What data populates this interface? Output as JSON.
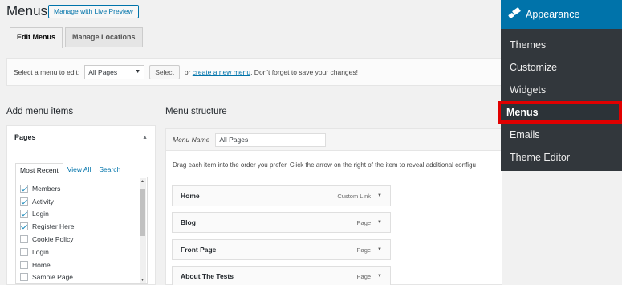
{
  "header": {
    "title": "Menus",
    "live_preview_label": "Manage with Live Preview"
  },
  "tabs": [
    {
      "label": "Edit Menus",
      "active": true
    },
    {
      "label": "Manage Locations",
      "active": false
    }
  ],
  "select_bar": {
    "label": "Select a menu to edit:",
    "selected": "All Pages",
    "select_button": "Select",
    "or_text": "or",
    "create_link": "create a new menu",
    "tail_text": ". Don't forget to save your changes!"
  },
  "add_items": {
    "heading": "Add menu items",
    "panel_title": "Pages",
    "subtabs": [
      "Most Recent",
      "View All",
      "Search"
    ],
    "pages": [
      {
        "label": "Members",
        "checked": true
      },
      {
        "label": "Activity",
        "checked": true
      },
      {
        "label": "Login",
        "checked": true
      },
      {
        "label": "Register Here",
        "checked": true
      },
      {
        "label": "Cookie Policy",
        "checked": false
      },
      {
        "label": "Login",
        "checked": false
      },
      {
        "label": "Home",
        "checked": false
      },
      {
        "label": "Sample Page",
        "checked": false
      }
    ]
  },
  "structure": {
    "heading": "Menu structure",
    "name_label": "Menu Name",
    "name_value": "All Pages",
    "instructions": "Drag each item into the order you prefer. Click the arrow on the right of the item to reveal additional configu",
    "items": [
      {
        "title": "Home",
        "type": "Custom Link"
      },
      {
        "title": "Blog",
        "type": "Page"
      },
      {
        "title": "Front Page",
        "type": "Page"
      },
      {
        "title": "About The Tests",
        "type": "Page"
      }
    ]
  },
  "admin_menu": {
    "section": "Appearance",
    "items": [
      "Themes",
      "Customize",
      "Widgets",
      "Menus",
      "Emails",
      "Theme Editor"
    ],
    "current": "Menus"
  },
  "colors": {
    "admin_bg": "#32373c",
    "admin_active": "#0073aa",
    "highlight_border": "#e00000"
  }
}
